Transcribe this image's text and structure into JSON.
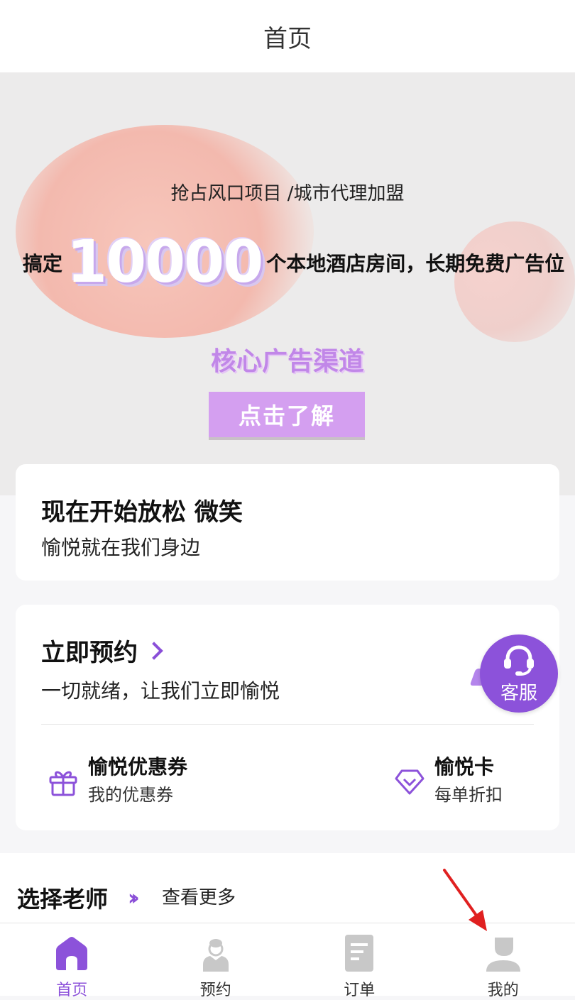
{
  "header": {
    "title": "首页"
  },
  "banner": {
    "tagline": "抢占风口项目 /城市代理加盟",
    "headline_prefix": "搞定",
    "headline_number": "10000",
    "headline_suffix": "个本地酒店房间，长期免费广告位",
    "channel": "核心广告渠道",
    "cta": "点击了解"
  },
  "relax_card": {
    "title": "现在开始放松 微笑",
    "subtitle": "愉悦就在我们身边"
  },
  "booking_card": {
    "title": "立即预约",
    "subtitle": "一切就绪，让我们立即愉悦",
    "features": [
      {
        "title": "愉悦优惠券",
        "subtitle": "我的优惠券",
        "icon": "gift-icon"
      },
      {
        "title": "愉悦卡",
        "subtitle": "每单折扣",
        "icon": "diamond-icon"
      }
    ]
  },
  "customer_service": {
    "label": "客服",
    "icon": "headset-icon"
  },
  "teachers": {
    "title": "选择老师",
    "more": "查看更多"
  },
  "tabbar": [
    {
      "label": "首页",
      "icon": "home-icon",
      "active": true
    },
    {
      "label": "预约",
      "icon": "person-icon",
      "active": false
    },
    {
      "label": "订单",
      "icon": "document-icon",
      "active": false
    },
    {
      "label": "我的",
      "icon": "profile-icon",
      "active": false
    }
  ],
  "colors": {
    "accent": "#8c52da",
    "banner_cta": "#d49ff0",
    "annotation_arrow": "#e02020"
  }
}
